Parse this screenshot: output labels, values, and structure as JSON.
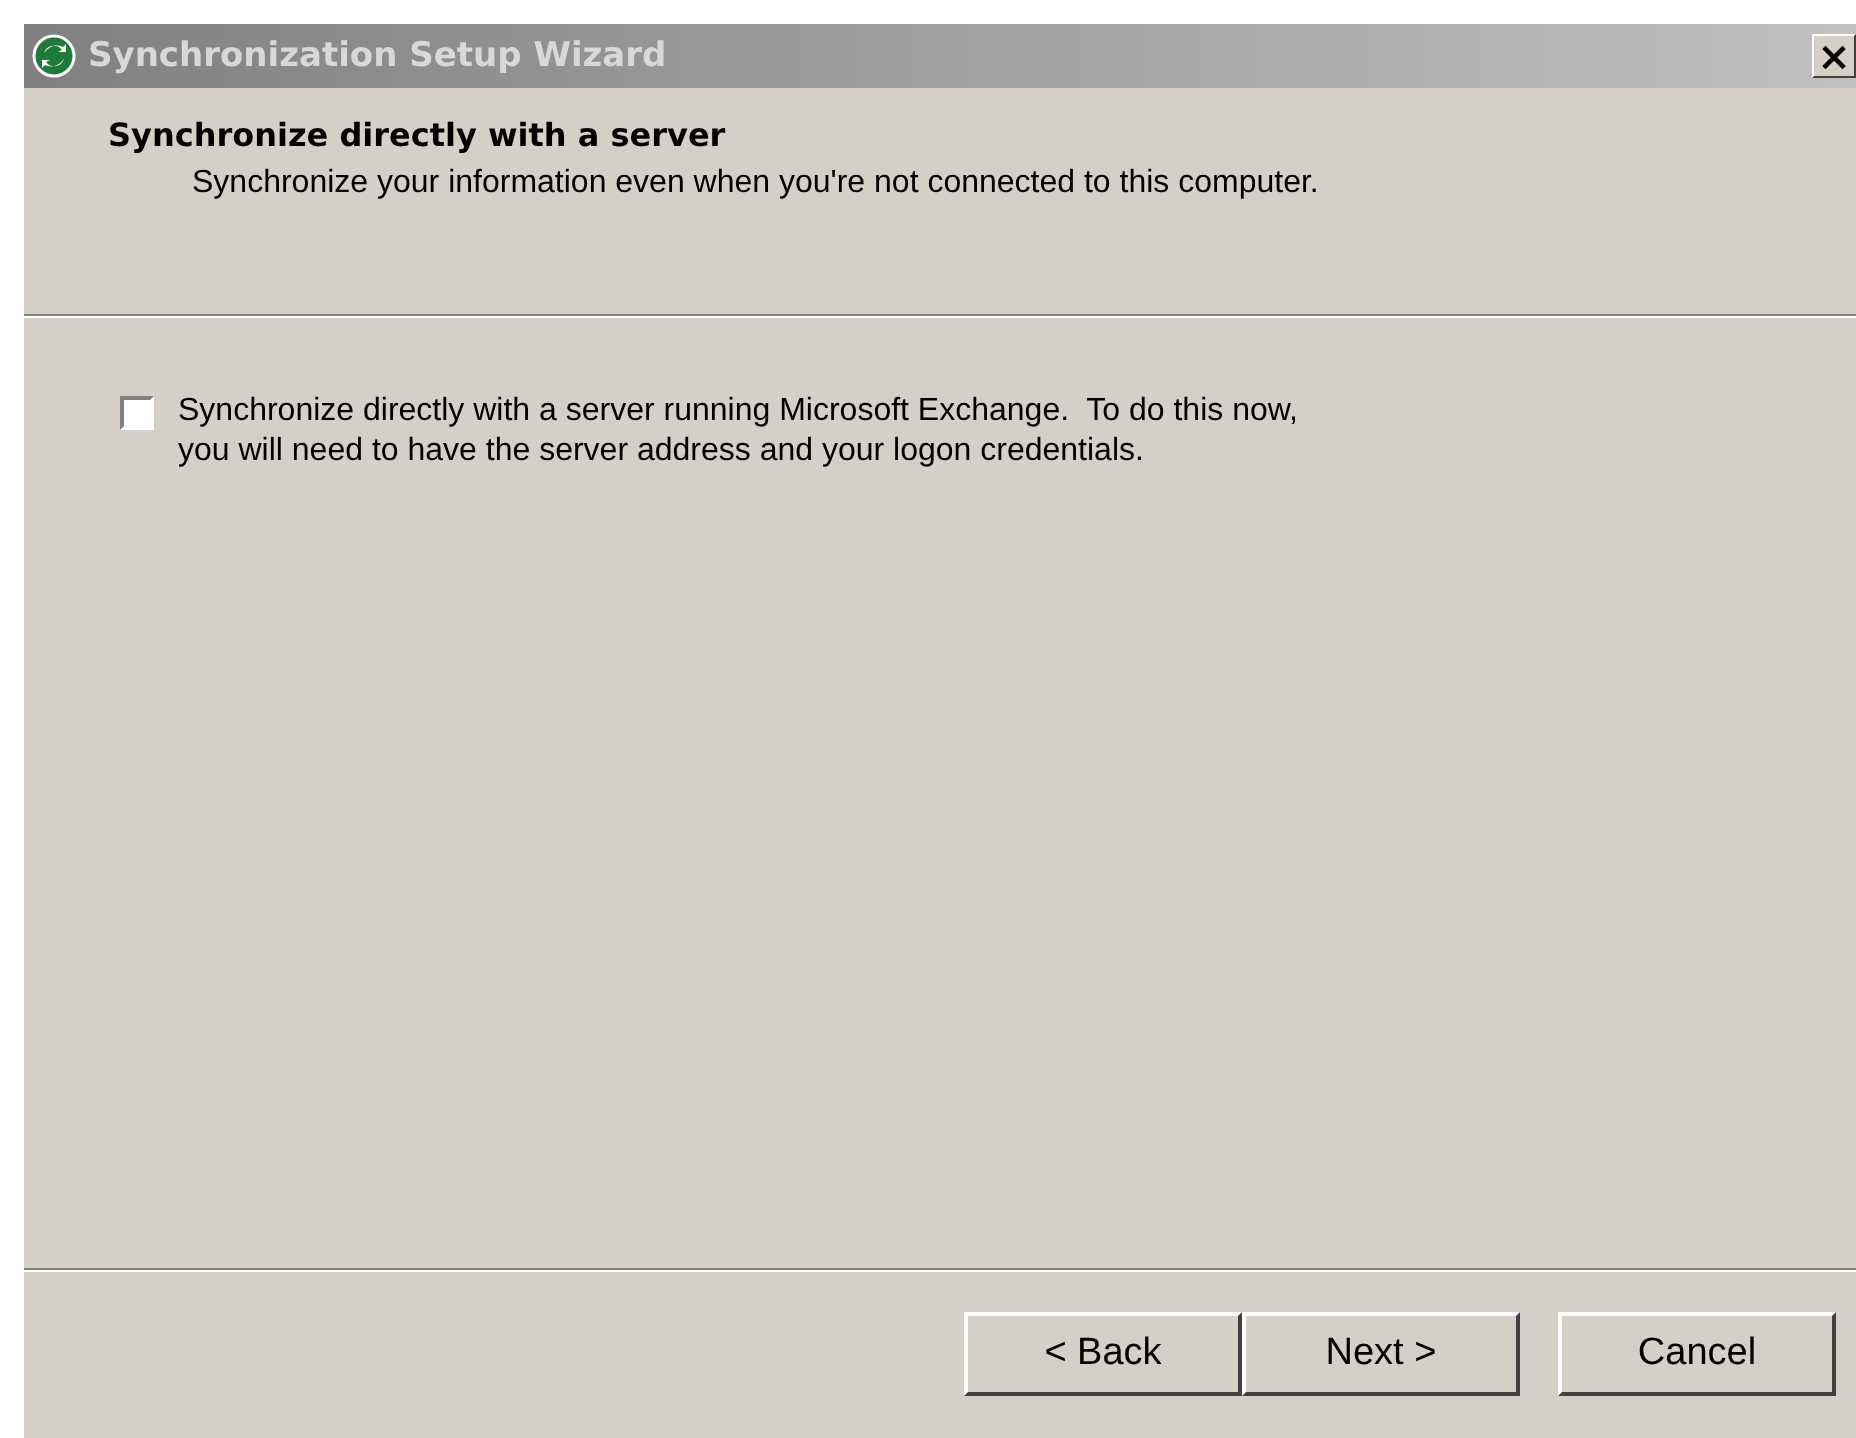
{
  "window": {
    "title": "Synchronization Setup Wizard",
    "close": "×"
  },
  "header": {
    "title": "Synchronize directly with a server",
    "subtitle": "Synchronize your information even when you're not connected to this computer."
  },
  "option": {
    "label": "Synchronize directly with a server running Microsoft Exchange.  To do this now,\nyou will need to have the server address and your logon credentials.",
    "checked": false
  },
  "buttons": [
    {
      "label": "< Back",
      "kind": "back"
    },
    {
      "label": "Next >",
      "kind": "next"
    },
    {
      "label": "Cancel",
      "kind": "cancel"
    }
  ]
}
